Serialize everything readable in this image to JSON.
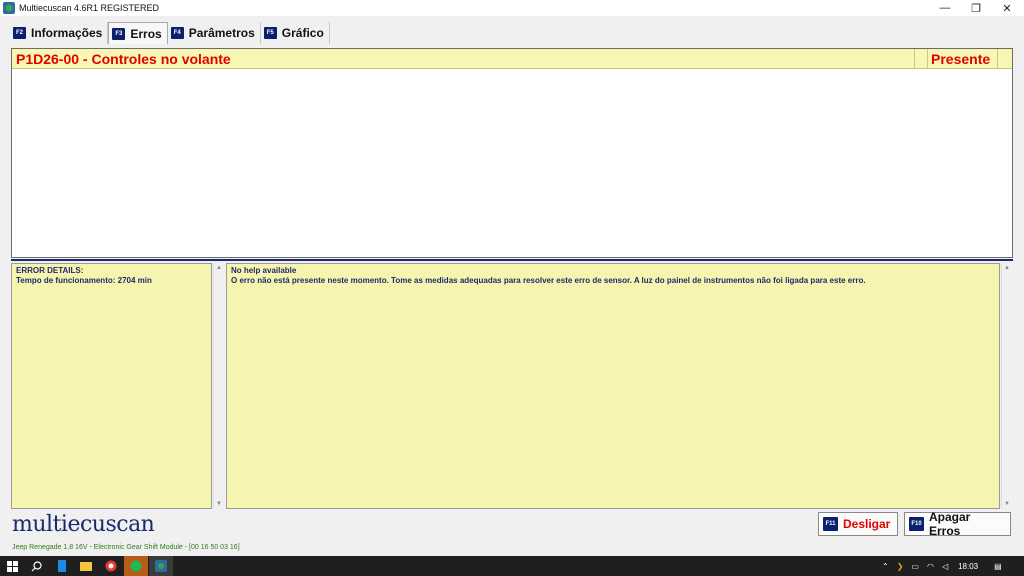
{
  "window": {
    "title": "Multiecuscan 4.6R1 REGISTERED",
    "minimize_glyph": "—",
    "restore_glyph": "❐",
    "close_glyph": "✕"
  },
  "tabs": [
    {
      "key": "F2",
      "label": "Informações",
      "active": false
    },
    {
      "key": "F3",
      "label": "Erros",
      "active": true
    },
    {
      "key": "F4",
      "label": "Parâmetros",
      "active": false
    },
    {
      "key": "F5",
      "label": "Gráfico",
      "active": false
    }
  ],
  "errors": [
    {
      "code": "P1D26-00 - Controles no volante",
      "status": "Presente"
    }
  ],
  "details": {
    "heading": "ERROR DETAILS:",
    "runtime": "Tempo de funcionamento: 2704 min"
  },
  "help": {
    "heading": "No help available",
    "text": "O erro não está presente neste momento. Tome as medidas adequadas para resolver este erro de sensor. A luz do painel de instrumentos não foi ligada para este erro."
  },
  "logo": "multiecuscan",
  "buttons": {
    "disconnect": {
      "key": "F11",
      "label": "Desligar",
      "color": "#e20000"
    },
    "clear": {
      "key": "F10",
      "label": "Apagar Erros",
      "color": "#111111"
    }
  },
  "status_bar": "Jeep Renegade 1.8 16V - Electronic Gear Shift Module - [00 16 50 03 16]",
  "taskbar": {
    "clock": "18:03"
  },
  "colors": {
    "error_text": "#e20000",
    "error_row": "#f7f6b2",
    "pane_bg": "#f5f5b0",
    "accent": "#1b2a6b"
  }
}
